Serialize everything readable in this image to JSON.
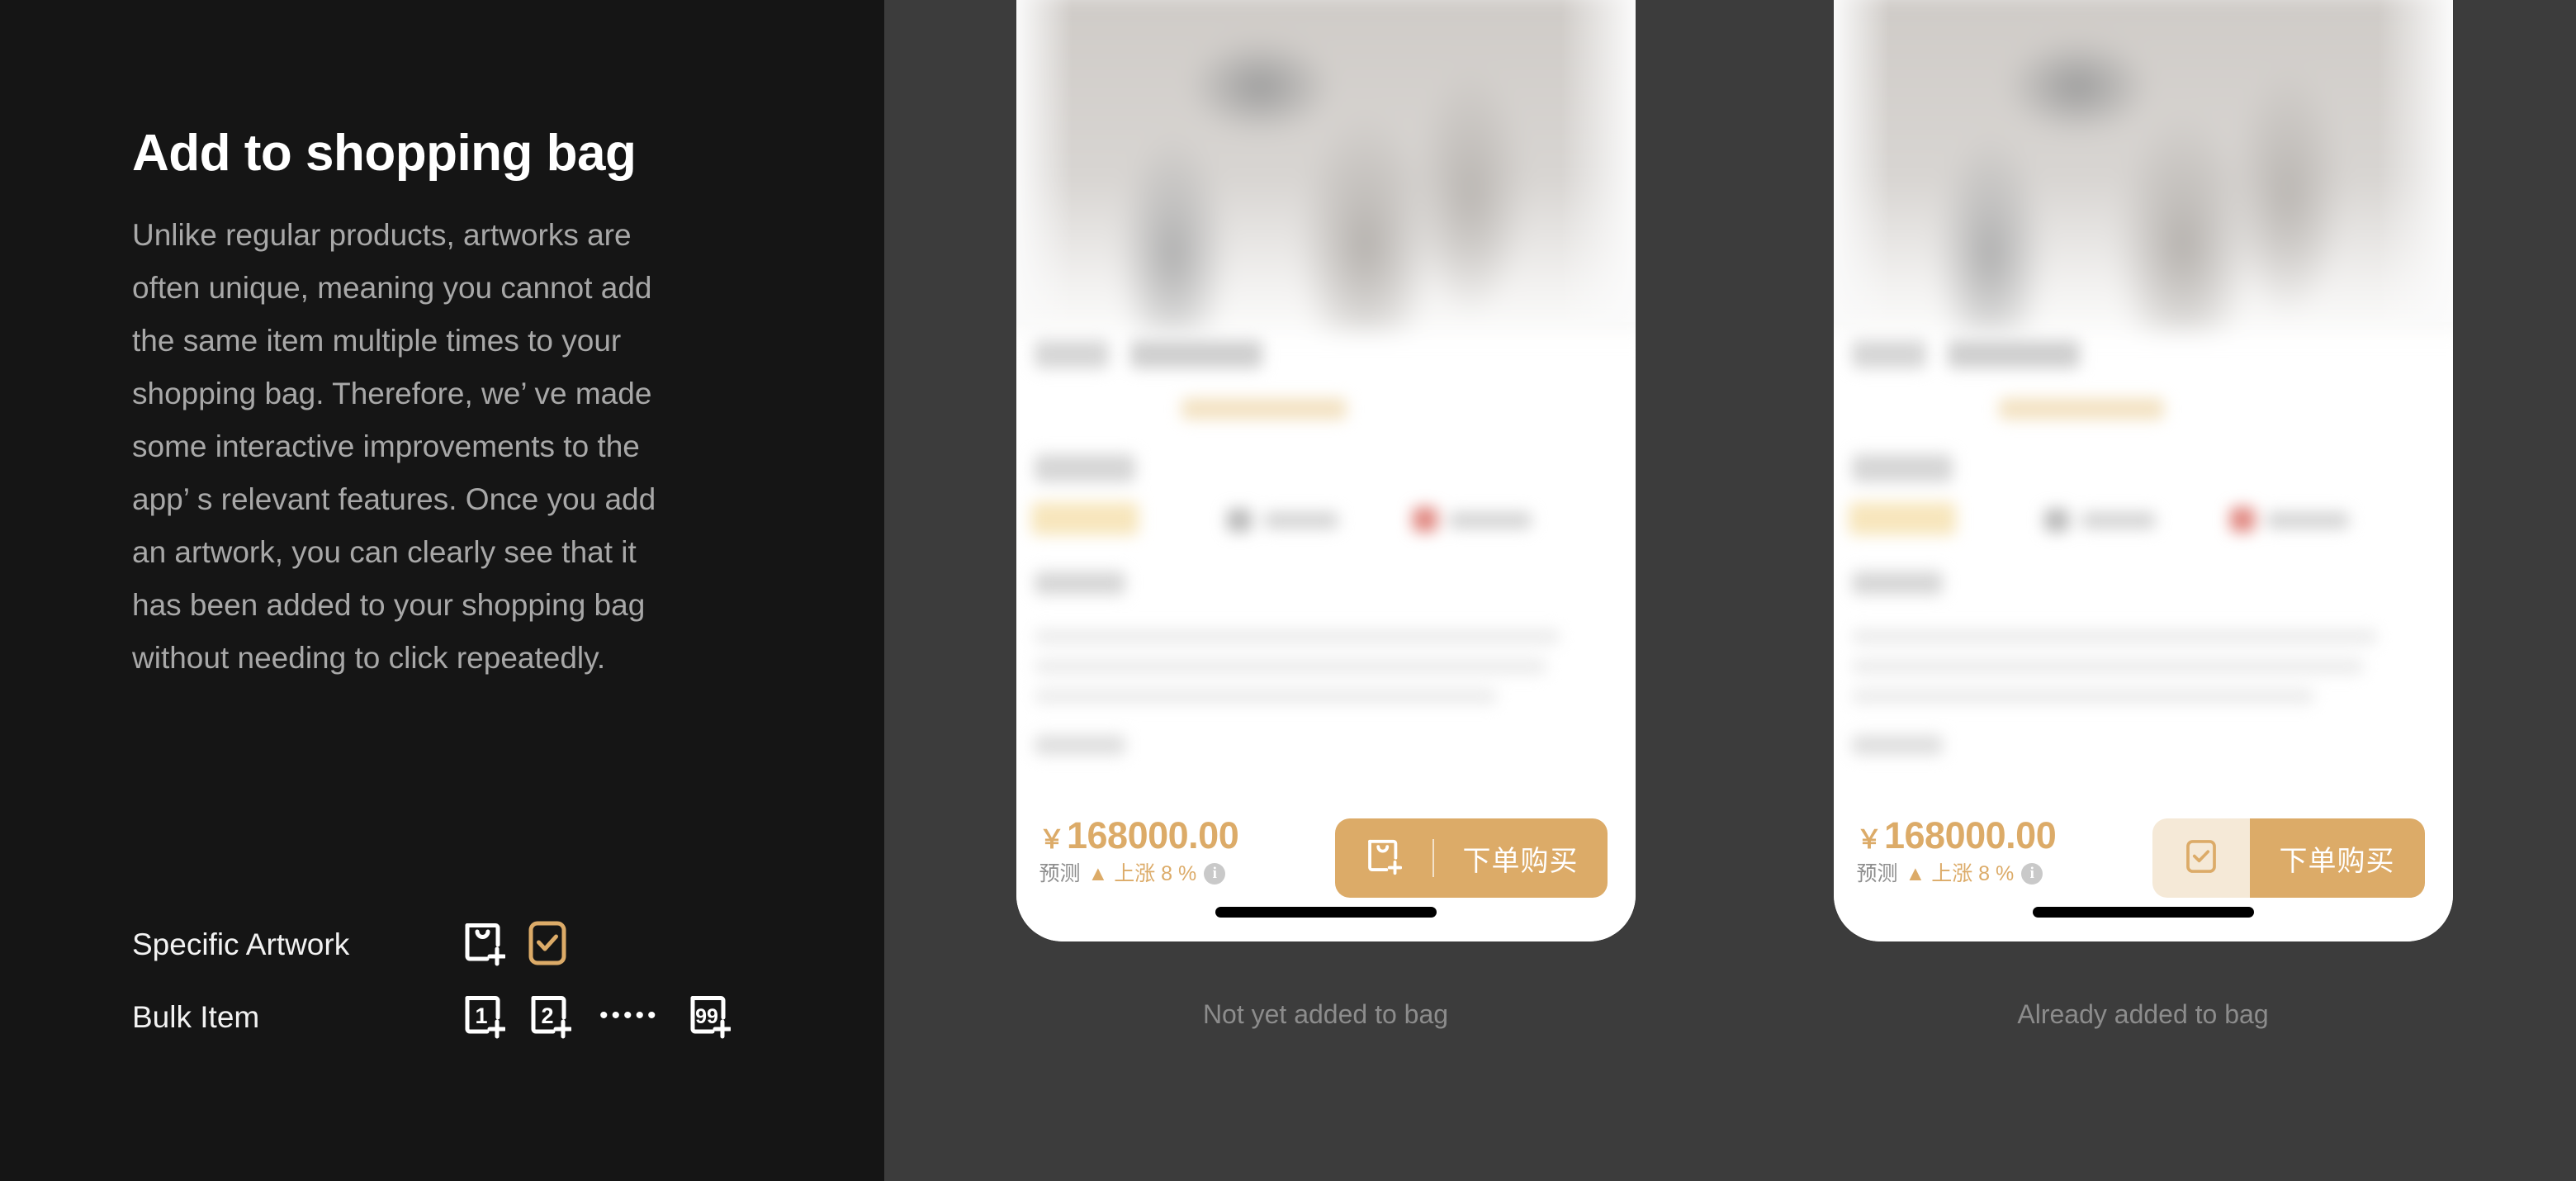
{
  "left": {
    "title": "Add to shopping bag",
    "body": "Unlike regular products, artworks are often unique, meaning you cannot add the same item multiple times to your shopping bag. Therefore, we’ ve made some interactive improvements to the app’ s relevant features. Once you add an artwork, you can clearly see that it has been added to your shopping bag without needing to click repeatedly.",
    "legend": {
      "rows": [
        {
          "label": "Specific Artwork",
          "icons": [
            {
              "name": "bag-add-icon",
              "kind": "bag-plus",
              "text": "",
              "color": "#ffffff"
            },
            {
              "name": "bag-checked-icon",
              "kind": "check-box",
              "text": "",
              "color": "#dcab68"
            }
          ]
        },
        {
          "label": "Bulk Item",
          "icons": [
            {
              "name": "qty-1-add-icon",
              "kind": "num-plus",
              "text": "1",
              "color": "#ffffff"
            },
            {
              "name": "qty-2-add-icon",
              "kind": "num-plus",
              "text": "2",
              "color": "#ffffff"
            },
            {
              "name": "ellipsis-separator",
              "kind": "dots",
              "text": "•••••",
              "color": "#ffffff"
            },
            {
              "name": "qty-99-add-icon",
              "kind": "num-plus",
              "text": "99",
              "color": "#ffffff"
            }
          ]
        }
      ]
    }
  },
  "phones": [
    {
      "state": "not-added",
      "caption": "Not yet added to bag",
      "price": "168000.00",
      "currency_symbol": "￥",
      "forecast_label": "预测",
      "forecast_trend": "▲ 上涨 8 %",
      "info_glyph": "i",
      "cta_label": "下单购买",
      "cta_icon": "bag-add-icon"
    },
    {
      "state": "added",
      "caption": "Already added to bag",
      "price": "168000.00",
      "currency_symbol": "￥",
      "forecast_label": "预测",
      "forecast_trend": "▲ 上涨 8 %",
      "info_glyph": "i",
      "cta_label": "下单购买",
      "cta_icon": "bag-checked-icon"
    }
  ],
  "colors": {
    "panel_dark": "#151515",
    "panel_grey": "#3c3c3c",
    "gold": "#dcab68",
    "gold_light": "#f5e9d7",
    "body_text": "#a8a8a8",
    "caption": "#8c8c8c"
  }
}
